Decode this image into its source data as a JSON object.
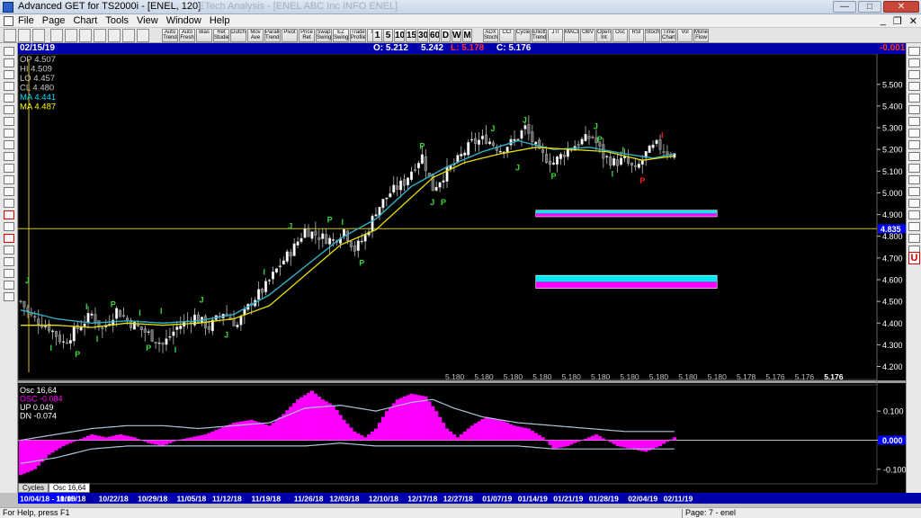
{
  "window": {
    "title": "Advanced GET for TS2000i - [ENEL, 120]",
    "ghost_title": "ETech  Analysis - [ENEL  ABC Inc  INFO  ENEL]"
  },
  "menu": {
    "items": [
      "File",
      "Page",
      "Chart",
      "Tools",
      "View",
      "Window",
      "Help"
    ],
    "mdi": [
      "_",
      "❐",
      "✕"
    ]
  },
  "toolbar": {
    "left_buttons": [
      "Auto Trend",
      "Auto Fresh",
      "Bias",
      "Ret Studies",
      "Dutch",
      "Mov Ave",
      "Parallel Trends",
      "Pivot",
      "Price Ret",
      "Swap Swing",
      "EZ Swing",
      "Trade Profile",
      "XTC"
    ],
    "timeframes": [
      "1",
      "5",
      "10",
      "15",
      "30",
      "60",
      "D",
      "W",
      "M"
    ],
    "right_buttons": [
      "ADX Stoch",
      "CCI",
      "Cycles",
      "Elliott Trend",
      "JTI",
      "MACD",
      "OBV",
      "Open Int",
      "Osc",
      "RSI",
      "Stoch",
      "Time Chart",
      "Vol",
      "Money Flow"
    ]
  },
  "info": {
    "date": "02/15/19",
    "open": "O: 5.212",
    "high": "5.242",
    "low": "L: 5.178",
    "close": "C: 5.176",
    "change": "-0.001"
  },
  "colors": {
    "background": "#000000",
    "bull": "#ffffff",
    "ma_fast": "#2fb0c8",
    "ma_slow": "#e8e000",
    "osc": "#ff00ff",
    "band": "#a9c4dc",
    "cyan": "#00e8f0",
    "magenta": "#ff00ff",
    "label_green": "#39d939",
    "label_red": "#ff2020",
    "axis_highlight": "#0000ff"
  },
  "chart_data": [
    {
      "type": "candlestick",
      "title": "",
      "legend": [
        {
          "label": "OP",
          "value": "4.507",
          "color": "#c8c8c8"
        },
        {
          "label": "HI",
          "value": "4.509",
          "color": "#c8c8c8"
        },
        {
          "label": "LO",
          "value": "4.457",
          "color": "#c8c8c8"
        },
        {
          "label": "CL",
          "value": "4.480",
          "color": "#c8c8c8"
        },
        {
          "label": "MA",
          "value": "4.441",
          "color": "#00e0ff"
        },
        {
          "label": "MA",
          "value": "4.487",
          "color": "#ffff00"
        }
      ],
      "ylim": [
        4.14,
        5.64
      ],
      "yticks": [
        4.2,
        4.3,
        4.4,
        4.5,
        4.6,
        4.7,
        4.8,
        4.9,
        5.0,
        5.1,
        5.2,
        5.3,
        5.4,
        5.5
      ],
      "ytick_labels": [
        "4.200",
        "4.300",
        "4.400",
        "4.500",
        "4.600",
        "4.700",
        "4.800",
        "4.900",
        "5.000",
        "5.100",
        "5.200",
        "5.300",
        "5.400",
        "5.500"
      ],
      "close_profile": [
        [
          0,
          4.5
        ],
        [
          3,
          4.43
        ],
        [
          8,
          4.38
        ],
        [
          12,
          4.31
        ],
        [
          15,
          4.36
        ],
        [
          20,
          4.44
        ],
        [
          23,
          4.37
        ],
        [
          27,
          4.46
        ],
        [
          31,
          4.4
        ],
        [
          36,
          4.35
        ],
        [
          40,
          4.3
        ],
        [
          44,
          4.38
        ],
        [
          49,
          4.43
        ],
        [
          53,
          4.38
        ],
        [
          57,
          4.45
        ],
        [
          61,
          4.39
        ],
        [
          65,
          4.5
        ],
        [
          69,
          4.57
        ],
        [
          73,
          4.67
        ],
        [
          77,
          4.75
        ],
        [
          80,
          4.83
        ],
        [
          84,
          4.8
        ],
        [
          88,
          4.78
        ],
        [
          91,
          4.83
        ],
        [
          94,
          4.74
        ],
        [
          97,
          4.8
        ],
        [
          100,
          4.92
        ],
        [
          104,
          5.0
        ],
        [
          108,
          5.05
        ],
        [
          111,
          5.13
        ],
        [
          113,
          5.17
        ],
        [
          116,
          5.02
        ],
        [
          119,
          5.08
        ],
        [
          123,
          5.15
        ],
        [
          127,
          5.23
        ],
        [
          131,
          5.25
        ],
        [
          135,
          5.2
        ],
        [
          139,
          5.24
        ],
        [
          142,
          5.3
        ],
        [
          146,
          5.18
        ],
        [
          150,
          5.14
        ],
        [
          154,
          5.2
        ],
        [
          158,
          5.24
        ],
        [
          161,
          5.26
        ],
        [
          164,
          5.17
        ],
        [
          167,
          5.14
        ],
        [
          170,
          5.15
        ],
        [
          173,
          5.1
        ],
        [
          176,
          5.18
        ],
        [
          179,
          5.22
        ],
        [
          182,
          5.19
        ],
        [
          184,
          5.176
        ]
      ],
      "ma_fast": [
        [
          0,
          4.46
        ],
        [
          10,
          4.42
        ],
        [
          20,
          4.4
        ],
        [
          30,
          4.41
        ],
        [
          40,
          4.4
        ],
        [
          50,
          4.41
        ],
        [
          60,
          4.44
        ],
        [
          70,
          4.53
        ],
        [
          80,
          4.66
        ],
        [
          90,
          4.79
        ],
        [
          100,
          4.88
        ],
        [
          110,
          5.03
        ],
        [
          120,
          5.12
        ],
        [
          130,
          5.19
        ],
        [
          140,
          5.24
        ],
        [
          150,
          5.2
        ],
        [
          160,
          5.21
        ],
        [
          170,
          5.18
        ],
        [
          178,
          5.16
        ],
        [
          184,
          5.18
        ]
      ],
      "ma_slow": [
        [
          0,
          4.39
        ],
        [
          10,
          4.39
        ],
        [
          20,
          4.38
        ],
        [
          30,
          4.4
        ],
        [
          40,
          4.39
        ],
        [
          50,
          4.4
        ],
        [
          60,
          4.42
        ],
        [
          70,
          4.48
        ],
        [
          80,
          4.62
        ],
        [
          90,
          4.76
        ],
        [
          100,
          4.83
        ],
        [
          108,
          4.95
        ],
        [
          116,
          5.07
        ],
        [
          125,
          5.14
        ],
        [
          135,
          5.18
        ],
        [
          145,
          5.21
        ],
        [
          155,
          5.2
        ],
        [
          165,
          5.19
        ],
        [
          175,
          5.15
        ],
        [
          184,
          5.17
        ]
      ],
      "horizontal_line": {
        "value": 4.835,
        "label": "4.835"
      },
      "projection_boxes": [
        {
          "x_from": 145,
          "x_to": 196,
          "top": 4.92,
          "bottom": 4.89
        },
        {
          "x_from": 145,
          "x_to": 196,
          "top": 4.62,
          "bottom": 4.56
        }
      ],
      "pivot_labels": [
        {
          "bar": 2,
          "value": 4.6,
          "text": "J",
          "color": "green"
        },
        {
          "bar": 9,
          "value": 4.29,
          "text": "I",
          "color": "green"
        },
        {
          "bar": 16,
          "value": 4.26,
          "text": "P",
          "color": "green"
        },
        {
          "bar": 19,
          "value": 4.48,
          "text": "I",
          "color": "green"
        },
        {
          "bar": 22,
          "value": 4.33,
          "text": "I",
          "color": "green"
        },
        {
          "bar": 26,
          "value": 4.49,
          "text": "P",
          "color": "green"
        },
        {
          "bar": 34,
          "value": 4.45,
          "text": "I",
          "color": "green"
        },
        {
          "bar": 36,
          "value": 4.29,
          "text": "P",
          "color": "green"
        },
        {
          "bar": 40,
          "value": 4.46,
          "text": "I",
          "color": "green"
        },
        {
          "bar": 44,
          "value": 4.28,
          "text": "I",
          "color": "green"
        },
        {
          "bar": 51,
          "value": 4.51,
          "text": "J",
          "color": "green"
        },
        {
          "bar": 58,
          "value": 4.35,
          "text": "J",
          "color": "green"
        },
        {
          "bar": 69,
          "value": 4.64,
          "text": "I",
          "color": "green"
        },
        {
          "bar": 76,
          "value": 4.85,
          "text": "J",
          "color": "green"
        },
        {
          "bar": 87,
          "value": 4.88,
          "text": "P",
          "color": "green"
        },
        {
          "bar": 91,
          "value": 4.87,
          "text": "I",
          "color": "green"
        },
        {
          "bar": 96,
          "value": 4.68,
          "text": "P",
          "color": "green"
        },
        {
          "bar": 113,
          "value": 5.22,
          "text": "P",
          "color": "green"
        },
        {
          "bar": 116,
          "value": 4.96,
          "text": "J",
          "color": "green"
        },
        {
          "bar": 119,
          "value": 4.96,
          "text": "P",
          "color": "green"
        },
        {
          "bar": 133,
          "value": 5.3,
          "text": "J",
          "color": "green"
        },
        {
          "bar": 140,
          "value": 5.12,
          "text": "J",
          "color": "green"
        },
        {
          "bar": 142,
          "value": 5.34,
          "text": "J",
          "color": "green"
        },
        {
          "bar": 150,
          "value": 5.08,
          "text": "P",
          "color": "green"
        },
        {
          "bar": 162,
          "value": 5.31,
          "text": "J",
          "color": "green"
        },
        {
          "bar": 163,
          "value": 5.25,
          "text": "P",
          "color": "green"
        },
        {
          "bar": 167,
          "value": 5.09,
          "text": "I",
          "color": "green"
        },
        {
          "bar": 170,
          "value": 5.2,
          "text": "I",
          "color": "green"
        },
        {
          "bar": 175,
          "value": 5.06,
          "text": "P",
          "color": "red"
        },
        {
          "bar": 181,
          "value": 5.27,
          "text": "I",
          "color": "red"
        }
      ],
      "bottom_values": [
        "5.180",
        "5.180",
        "5.180",
        "5.180",
        "5.180",
        "5.180",
        "5.180",
        "5.180",
        "5.180",
        "5.180",
        "5.178",
        "5.176",
        "5.176",
        "5.176"
      ]
    },
    {
      "type": "area",
      "title": "Osc 16,64",
      "legend": [
        {
          "label": "Osc 16,64",
          "value": "",
          "color": "#ffffff"
        },
        {
          "label": "OSC",
          "value": "-0.084",
          "color": "#ff00ff"
        },
        {
          "label": "UP",
          "value": "0.049",
          "color": "#ffffff"
        },
        {
          "label": "DN",
          "value": "-0.074",
          "color": "#ffffff"
        }
      ],
      "ylim": [
        -0.15,
        0.19
      ],
      "yticks": [
        0.1,
        0.0,
        -0.1
      ],
      "ytick_labels": [
        "0.100",
        "0.000",
        "-0.100"
      ],
      "current_value_label": "0.000",
      "osc": [
        [
          0,
          -0.12
        ],
        [
          4,
          -0.1
        ],
        [
          8,
          -0.05
        ],
        [
          12,
          -0.02
        ],
        [
          16,
          0.0
        ],
        [
          20,
          0.02
        ],
        [
          24,
          0.01
        ],
        [
          28,
          0.02
        ],
        [
          32,
          0.01
        ],
        [
          36,
          -0.01
        ],
        [
          40,
          -0.02
        ],
        [
          44,
          0.0
        ],
        [
          48,
          0.01
        ],
        [
          52,
          0.02
        ],
        [
          56,
          0.04
        ],
        [
          60,
          0.06
        ],
        [
          65,
          0.07
        ],
        [
          70,
          0.05
        ],
        [
          74,
          0.09
        ],
        [
          78,
          0.14
        ],
        [
          82,
          0.17
        ],
        [
          85,
          0.14
        ],
        [
          88,
          0.12
        ],
        [
          91,
          0.07
        ],
        [
          94,
          0.03
        ],
        [
          97,
          0.01
        ],
        [
          100,
          0.04
        ],
        [
          103,
          0.1
        ],
        [
          106,
          0.14
        ],
        [
          110,
          0.16
        ],
        [
          114,
          0.15
        ],
        [
          117,
          0.1
        ],
        [
          120,
          0.04
        ],
        [
          123,
          0.01
        ],
        [
          127,
          0.05
        ],
        [
          131,
          0.08
        ],
        [
          135,
          0.07
        ],
        [
          139,
          0.05
        ],
        [
          143,
          0.04
        ],
        [
          147,
          0.01
        ],
        [
          150,
          -0.03
        ],
        [
          154,
          -0.02
        ],
        [
          158,
          0.0
        ],
        [
          162,
          0.02
        ],
        [
          165,
          0.0
        ],
        [
          168,
          -0.02
        ],
        [
          172,
          -0.03
        ],
        [
          176,
          -0.04
        ],
        [
          180,
          -0.02
        ],
        [
          184,
          0.01
        ]
      ],
      "band_upper": [
        [
          0,
          0.0
        ],
        [
          10,
          0.02
        ],
        [
          20,
          0.04
        ],
        [
          30,
          0.05
        ],
        [
          40,
          0.05
        ],
        [
          50,
          0.04
        ],
        [
          60,
          0.05
        ],
        [
          70,
          0.06
        ],
        [
          80,
          0.11
        ],
        [
          90,
          0.12
        ],
        [
          100,
          0.1
        ],
        [
          110,
          0.13
        ],
        [
          116,
          0.14
        ],
        [
          122,
          0.11
        ],
        [
          130,
          0.08
        ],
        [
          140,
          0.06
        ],
        [
          150,
          0.05
        ],
        [
          160,
          0.04
        ],
        [
          170,
          0.03
        ],
        [
          184,
          0.03
        ]
      ],
      "band_lower": [
        [
          0,
          -0.08
        ],
        [
          10,
          -0.06
        ],
        [
          20,
          -0.03
        ],
        [
          30,
          -0.02
        ],
        [
          40,
          -0.02
        ],
        [
          50,
          -0.02
        ],
        [
          60,
          -0.02
        ],
        [
          70,
          -0.02
        ],
        [
          80,
          -0.02
        ],
        [
          90,
          -0.01
        ],
        [
          100,
          -0.02
        ],
        [
          110,
          -0.02
        ],
        [
          120,
          -0.02
        ],
        [
          130,
          -0.02
        ],
        [
          140,
          -0.02
        ],
        [
          150,
          -0.03
        ],
        [
          160,
          -0.03
        ],
        [
          170,
          -0.03
        ],
        [
          184,
          -0.03
        ]
      ],
      "zero_line": 0.0
    }
  ],
  "date_axis": {
    "current": "10/04/18 - 11:00",
    "labels": [
      {
        "bar": 15,
        "text": "10/15/18"
      },
      {
        "bar": 27,
        "text": "10/22/18"
      },
      {
        "bar": 38,
        "text": "10/29/18"
      },
      {
        "bar": 49,
        "text": "11/05/18"
      },
      {
        "bar": 59,
        "text": "11/12/18"
      },
      {
        "bar": 70,
        "text": "11/19/18"
      },
      {
        "bar": 82,
        "text": "11/26/18"
      },
      {
        "bar": 92,
        "text": "12/03/18"
      },
      {
        "bar": 103,
        "text": "12/10/18"
      },
      {
        "bar": 114,
        "text": "12/17/18"
      },
      {
        "bar": 124,
        "text": "12/27/18"
      },
      {
        "bar": 135,
        "text": "01/07/19"
      },
      {
        "bar": 145,
        "text": "01/14/19"
      },
      {
        "bar": 155,
        "text": "01/21/19"
      },
      {
        "bar": 165,
        "text": "01/28/19"
      },
      {
        "bar": 176,
        "text": "02/04/19"
      },
      {
        "bar": 186,
        "text": "02/11/19"
      }
    ]
  },
  "tabs": [
    "Cycles",
    "Osc 16,64"
  ],
  "status": {
    "help": "For Help, press F1",
    "page": "Page: 7 - enel"
  }
}
